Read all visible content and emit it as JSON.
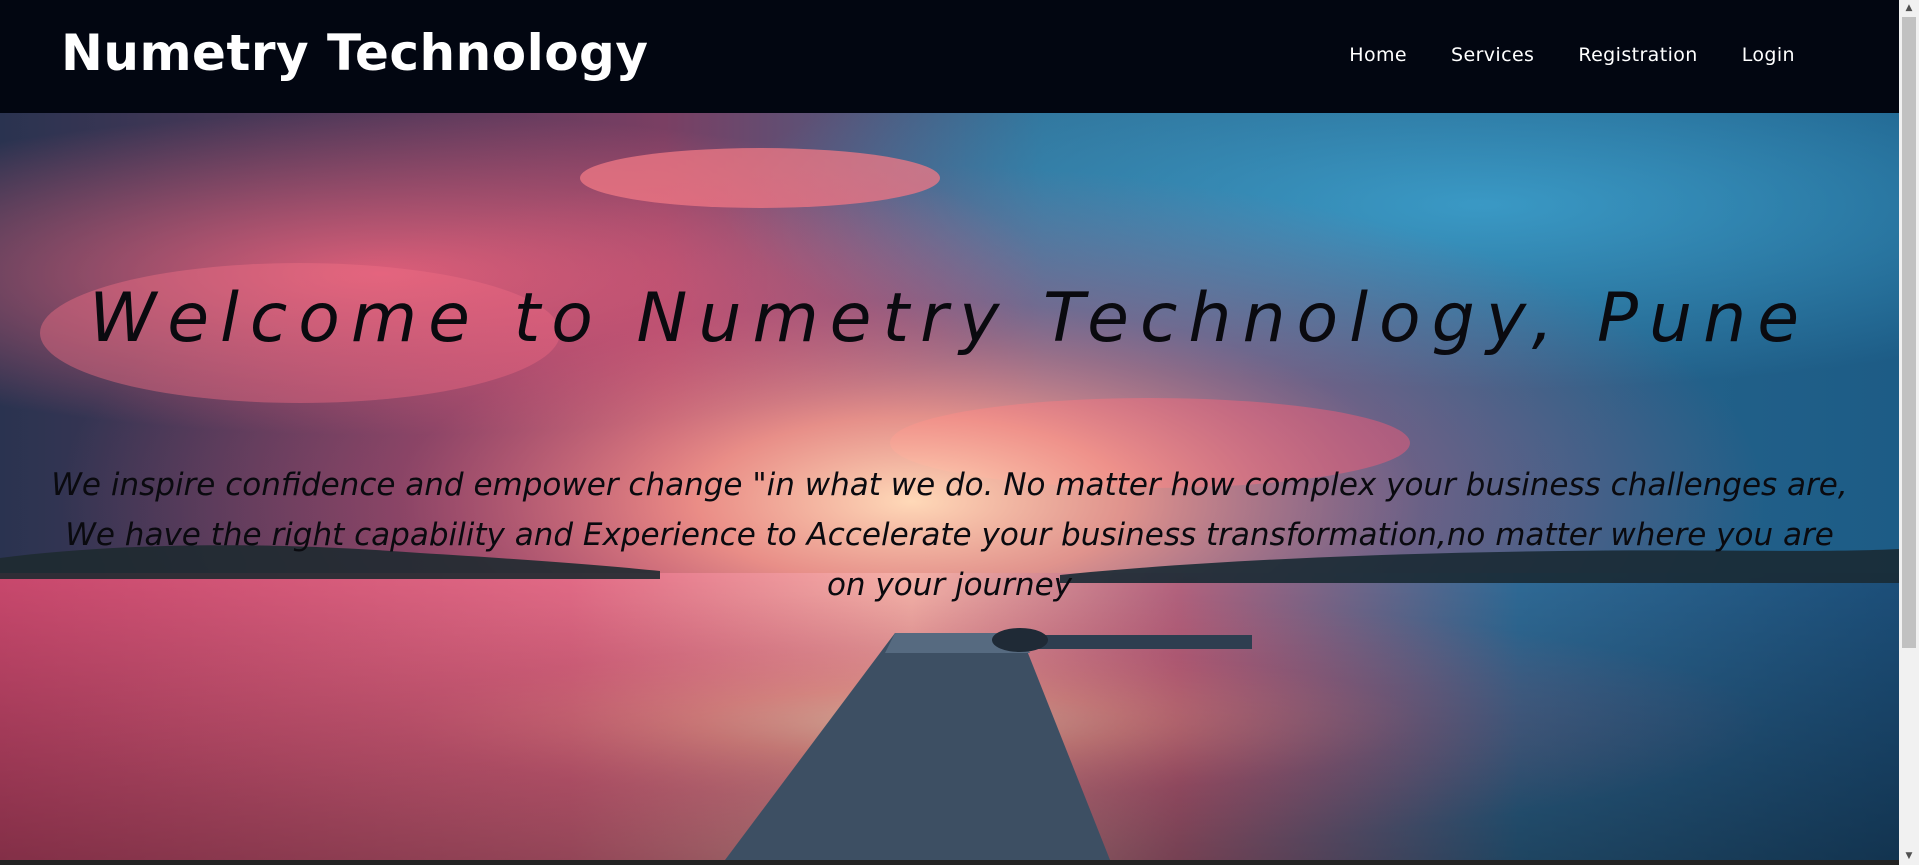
{
  "navbar": {
    "brand": "Numetry Technology",
    "links": [
      "Home",
      "Services",
      "Registration",
      "Login"
    ]
  },
  "hero": {
    "title": "Welcome to Numetry Technology, Pune",
    "tagline_lines": [
      "We inspire confidence and empower change \"in what we do. No matter how complex your business challenges are,",
      "We have the right capability and Experience to Accelerate your business transformation,no matter where you are",
      "on your journey"
    ]
  },
  "colors": {
    "navbar_bg": "#020611",
    "nav_text": "#ffffff",
    "hero_text": "#0a0a0f"
  },
  "icons": {
    "scroll_up": "▲",
    "scroll_down": "▼"
  }
}
